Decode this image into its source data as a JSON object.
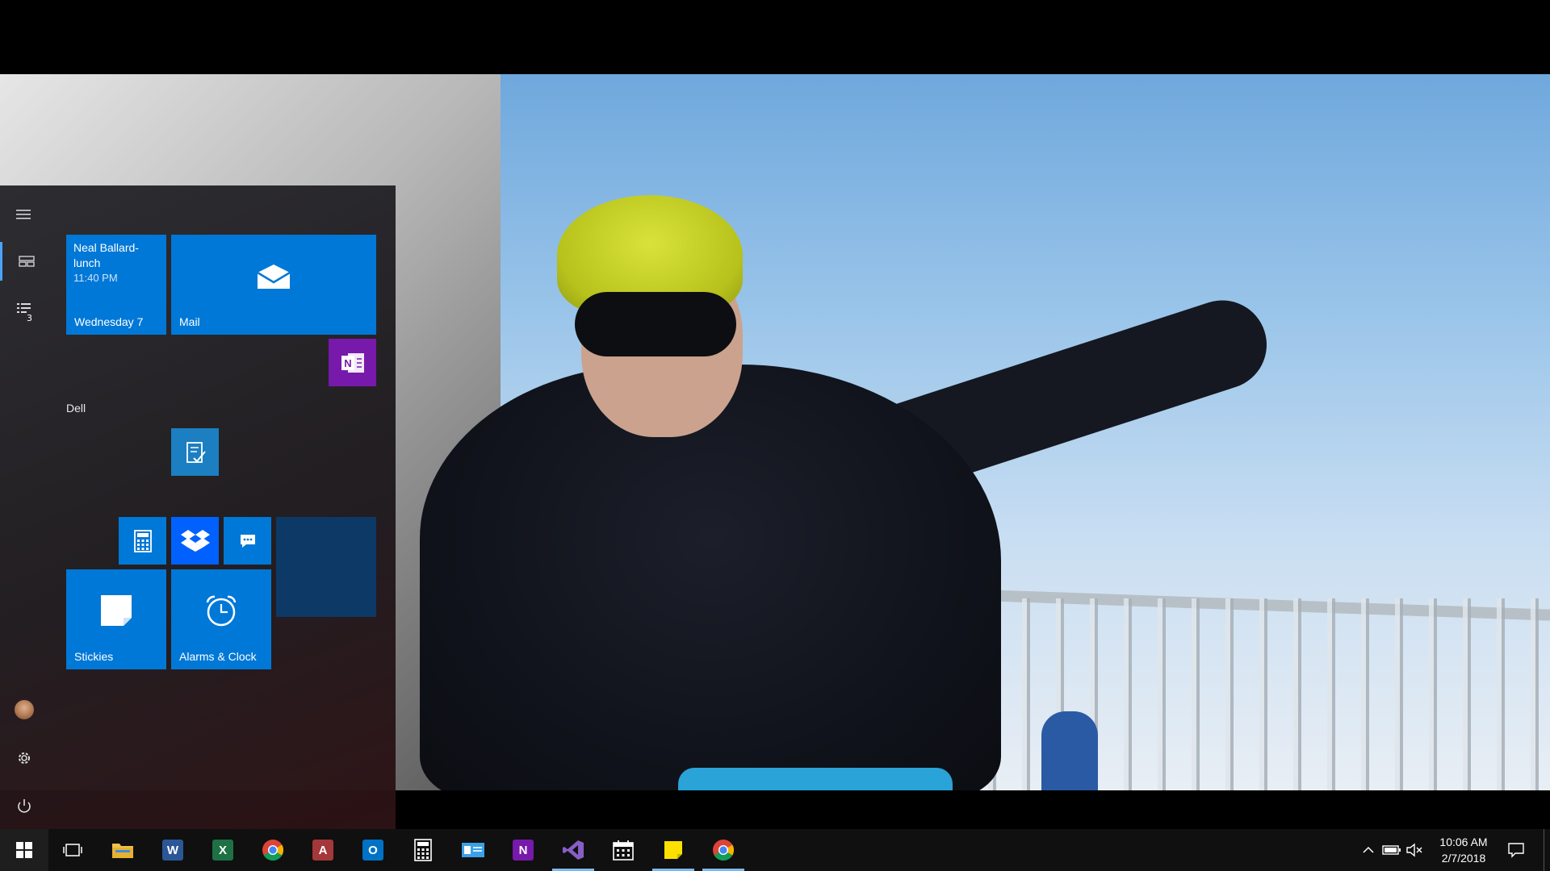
{
  "start_menu": {
    "calendar_tile": {
      "event": "Neal Ballard-lunch",
      "time": "11:40 PM",
      "day": "Wednesday 7"
    },
    "mail_tile": {
      "label": "Mail"
    },
    "group_label": "Dell",
    "stickies_tile": {
      "label": "Stickies"
    },
    "alarms_tile": {
      "label": "Alarms & Clock"
    },
    "rail_badge": "3",
    "rail_icons": [
      "hamburger-menu-icon",
      "tiles-icon",
      "all-apps-list-icon",
      "avatar",
      "settings-gear-icon",
      "power-icon"
    ]
  },
  "taskbar": {
    "clock": {
      "time": "10:06 AM",
      "date": "2/7/2018"
    },
    "apps": [
      {
        "name": "file-explorer",
        "glyph": ""
      },
      {
        "name": "word",
        "glyph": "W"
      },
      {
        "name": "excel",
        "glyph": "X"
      },
      {
        "name": "chrome",
        "glyph": ""
      },
      {
        "name": "access",
        "glyph": "A"
      },
      {
        "name": "outlook",
        "glyph": "O"
      },
      {
        "name": "calculator",
        "glyph": ""
      },
      {
        "name": "contact-card",
        "glyph": ""
      },
      {
        "name": "onenote",
        "glyph": "N"
      },
      {
        "name": "visual-studio",
        "glyph": ""
      },
      {
        "name": "calendar",
        "glyph": ""
      },
      {
        "name": "sticky-notes",
        "glyph": ""
      },
      {
        "name": "chrome-2",
        "glyph": ""
      }
    ]
  },
  "colors": {
    "tile_blue": "#0078d7",
    "onenote_purple": "#7719aa",
    "dark_tile": "#0c3966",
    "vs_purple": "#865fc5"
  }
}
